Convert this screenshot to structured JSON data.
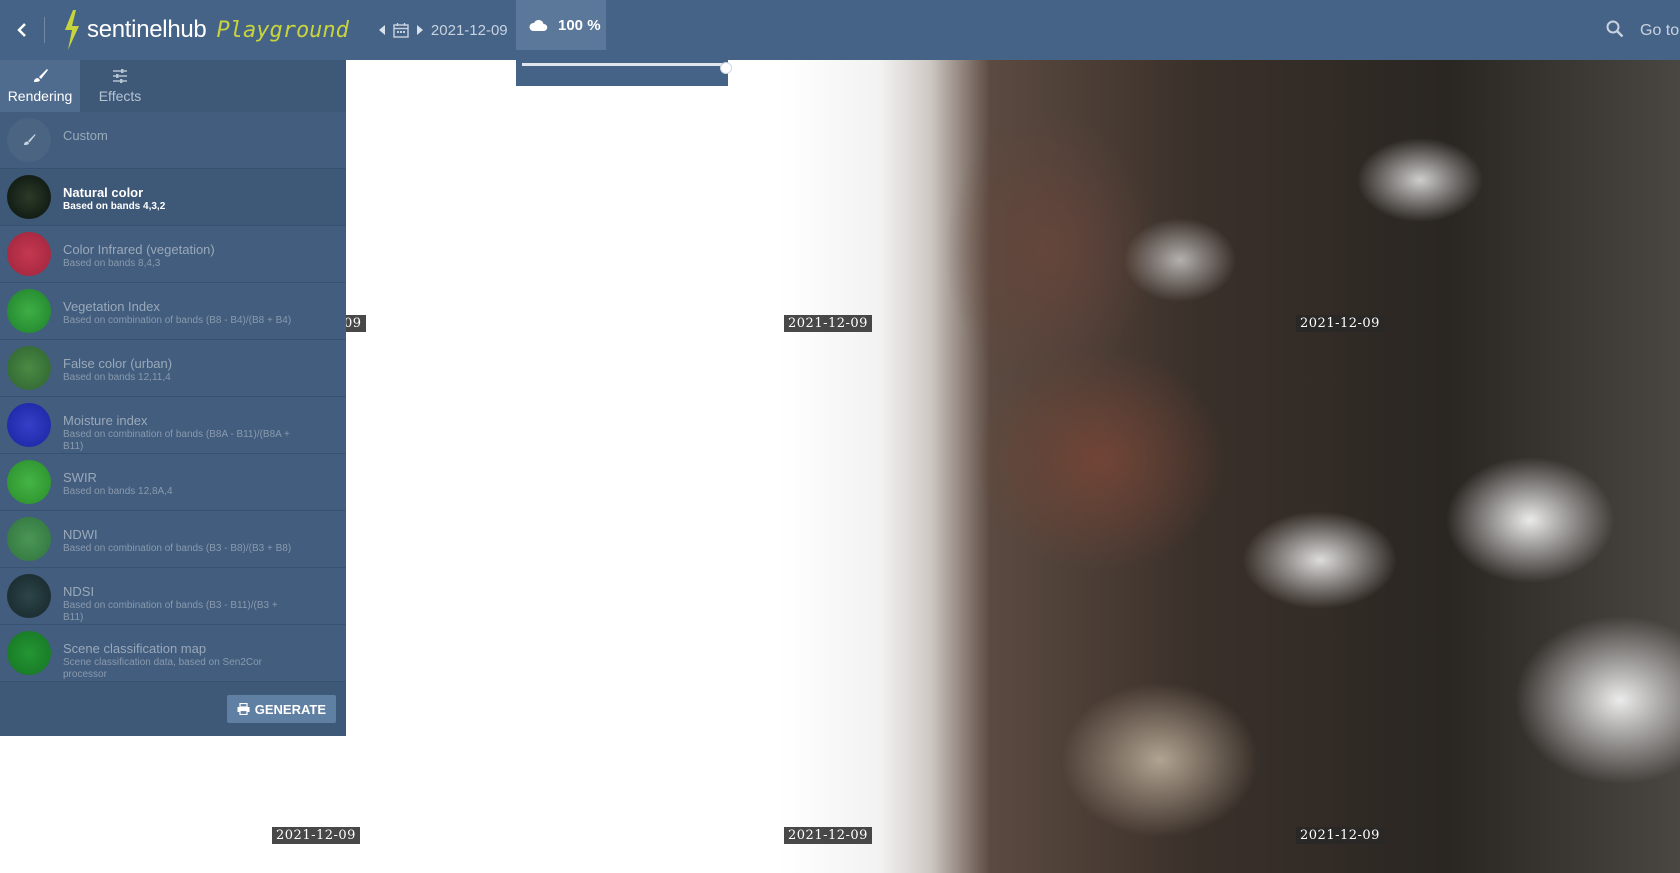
{
  "header": {
    "logo_name": "sentinelhub",
    "logo_sub": "Playground",
    "date": "2021-12-09",
    "cloud_coverage": "100 %",
    "goto_label": "Go to"
  },
  "sidebar": {
    "tabs": [
      {
        "label": "Rendering",
        "icon": "brush-icon",
        "active": true
      },
      {
        "label": "Effects",
        "icon": "sliders-icon",
        "active": false
      }
    ],
    "layers": [
      {
        "title": "Custom",
        "desc": "",
        "thumb_color": "#4a6482"
      },
      {
        "title": "Natural color",
        "desc": "Based on bands 4,3,2",
        "thumb_color": "#142417",
        "selected": true
      },
      {
        "title": "Color Infrared (vegetation)",
        "desc": "Based on bands 8,4,3",
        "thumb_color": "#b82e46"
      },
      {
        "title": "Vegetation Index",
        "desc": "Based on combination of bands (B8 - B4)/(B8 + B4)",
        "thumb_color": "#2e9a3a"
      },
      {
        "title": "False color (urban)",
        "desc": "Based on bands 12,11,4",
        "thumb_color": "#3e7a3c"
      },
      {
        "title": "Moisture index",
        "desc": "Based on combination of bands (B8A - B11)/(B8A + B11)",
        "thumb_color": "#2631b8"
      },
      {
        "title": "SWIR",
        "desc": "Based on bands 12,8A,4",
        "thumb_color": "#3aa63a"
      },
      {
        "title": "NDWI",
        "desc": "Based on combination of bands (B3 - B8)/(B3 + B8)",
        "thumb_color": "#3e8a4a"
      },
      {
        "title": "NDSI",
        "desc": "Based on combination of bands (B3 - B11)/(B3 + B11)",
        "thumb_color": "#22373c"
      },
      {
        "title": "Scene classification map",
        "desc": "Scene classification data, based on Sen2Cor processor",
        "thumb_color": "#1e8a2e"
      }
    ],
    "generate_label": "GENERATE"
  },
  "map": {
    "date_labels": [
      "09",
      "2021-12-09",
      "2021-12-09",
      "2021-12-09",
      "2021-12-09",
      "2021-12-09"
    ]
  }
}
